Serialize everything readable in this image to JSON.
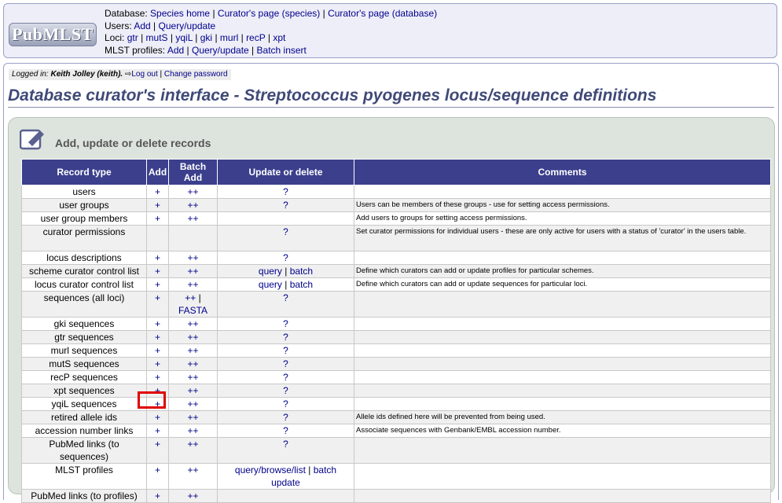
{
  "header": {
    "logo_text": "PubMLST",
    "database_label": "Database:",
    "database_links": [
      "Species home",
      "Curator's page (species)",
      "Curator's page (database)"
    ],
    "users_label": "Users:",
    "users_links": [
      "Add",
      "Query/update"
    ],
    "loci_label": "Loci:",
    "loci_links": [
      "gtr",
      "mutS",
      "yqiL",
      "gki",
      "murl",
      "recP",
      "xpt"
    ],
    "mlst_label": "MLST profiles:",
    "mlst_links": [
      "Add",
      "Query/update",
      "Batch insert"
    ]
  },
  "login": {
    "prefix": "Logged in:",
    "user": "Keith Jolley (keith).",
    "logout": "Log out",
    "separator": "|",
    "change_password": "Change password"
  },
  "page_title": "Database curator's interface - Streptococcus pyogenes locus/sequence definitions",
  "panel": {
    "title": "Add, update or delete records",
    "icon": "edit-icon"
  },
  "table": {
    "headers": [
      "Record type",
      "Add",
      "Batch Add",
      "Update or delete",
      "Comments"
    ],
    "rows": [
      {
        "type": "users",
        "add": "+",
        "batch": "++",
        "update": "?",
        "comment": ""
      },
      {
        "type": "user groups",
        "add": "+",
        "batch": "++",
        "update": "?",
        "comment": "Users can be members of these groups - use for setting access permissions."
      },
      {
        "type": "user group members",
        "add": "+",
        "batch": "++",
        "update": "",
        "comment": "Add users to groups for setting access permissions."
      },
      {
        "type": "curator permissions",
        "add": "",
        "batch": "",
        "update": "?",
        "comment": "Set curator permissions for individual users - these are only active for users with a status of 'curator' in the users table."
      },
      {
        "type": "locus descriptions",
        "add": "+",
        "batch": "++",
        "update": "?",
        "comment": ""
      },
      {
        "type": "scheme curator control list",
        "add": "+",
        "batch": "++",
        "update": "query | batch",
        "comment": "Define which curators can add or update profiles for particular schemes."
      },
      {
        "type": "locus curator control list",
        "add": "+",
        "batch": "++",
        "update": "query | batch",
        "comment": "Define which curators can add or update sequences for particular loci."
      },
      {
        "type": "sequences (all loci)",
        "add": "+",
        "batch": "++ | FASTA",
        "update": "?",
        "comment": ""
      },
      {
        "type": "gki sequences",
        "add": "+",
        "batch": "++",
        "update": "?",
        "comment": ""
      },
      {
        "type": "gtr sequences",
        "add": "+",
        "batch": "++",
        "update": "?",
        "comment": ""
      },
      {
        "type": "murl sequences",
        "add": "+",
        "batch": "++",
        "update": "?",
        "comment": ""
      },
      {
        "type": "mutS sequences",
        "add": "+",
        "batch": "++",
        "update": "?",
        "comment": ""
      },
      {
        "type": "recP sequences",
        "add": "+",
        "batch": "++",
        "update": "?",
        "comment": ""
      },
      {
        "type": "xpt sequences",
        "add": "+",
        "batch": "++",
        "update": "?",
        "comment": ""
      },
      {
        "type": "yqiL sequences",
        "add": "+",
        "batch": "++",
        "update": "?",
        "comment": ""
      },
      {
        "type": "retired allele ids",
        "add": "+",
        "batch": "++",
        "update": "?",
        "comment": "Allele ids defined here will be prevented from being used."
      },
      {
        "type": "accession number links",
        "add": "+",
        "batch": "++",
        "update": "?",
        "comment": "Associate sequences with Genbank/EMBL accession number."
      },
      {
        "type": "PubMed links (to sequences)",
        "add": "+",
        "batch": "++",
        "update": "?",
        "comment": ""
      },
      {
        "type": "MLST profiles",
        "add": "+",
        "batch": "++",
        "update": "query/browse/list | batch update",
        "comment": ""
      },
      {
        "type": "PubMed links (to profiles)",
        "add": "+",
        "batch": "++",
        "update": "",
        "comment": ""
      }
    ]
  },
  "colors": {
    "header_bg": "#3b3f8c",
    "title_color": "#404a78",
    "link_color": "#00008b",
    "highlight": "#e00000"
  }
}
